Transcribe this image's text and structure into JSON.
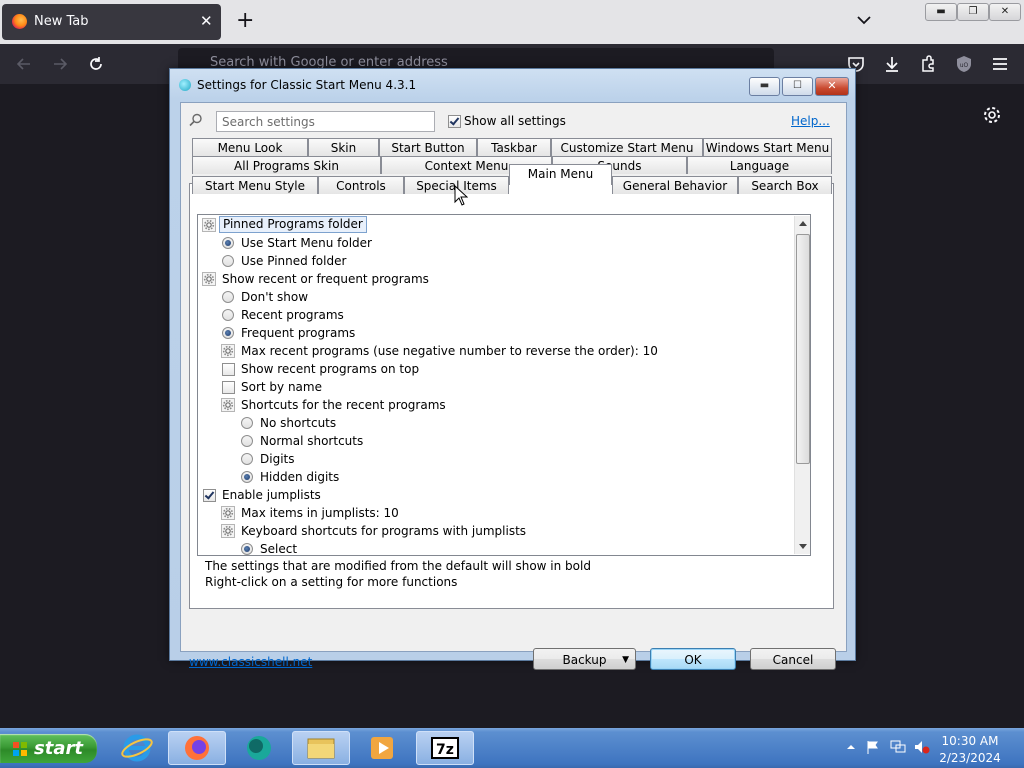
{
  "browser": {
    "tab_title": "New Tab",
    "url_placeholder": "Search with Google or enter address"
  },
  "dialog": {
    "title": "Settings for Classic Start Menu 4.3.1",
    "search_placeholder": "Search settings",
    "show_all_label": "Show all settings",
    "show_all_checked": true,
    "help_link": "Help...",
    "tabs_row1": [
      "Menu Look",
      "Skin",
      "Start Button",
      "Taskbar",
      "Customize Start Menu",
      "Windows Start Menu"
    ],
    "tabs_row2": [
      "All Programs Skin",
      "Context Menu",
      "Sounds",
      "Language"
    ],
    "tabs_row3": [
      "Start Menu Style",
      "Controls",
      "Special Items",
      "Main Menu",
      "General Behavior",
      "Search Box"
    ],
    "active_tab": "Main Menu",
    "settings": [
      {
        "label": "Pinned Programs folder",
        "kind": "group",
        "level": 0
      },
      {
        "label": "Use Start Menu folder",
        "kind": "radio",
        "checked": true,
        "level": 1
      },
      {
        "label": "Use Pinned folder",
        "kind": "radio",
        "checked": false,
        "level": 1
      },
      {
        "label": "Show recent or frequent programs",
        "kind": "group",
        "level": 0
      },
      {
        "label": "Don't show",
        "kind": "radio",
        "checked": false,
        "level": 1
      },
      {
        "label": "Recent programs",
        "kind": "radio",
        "checked": false,
        "level": 1
      },
      {
        "label": "Frequent programs",
        "kind": "radio",
        "checked": true,
        "level": 1
      },
      {
        "label": "Max recent programs (use negative number to reverse the order): 10",
        "kind": "group",
        "level": 1
      },
      {
        "label": "Show recent programs on top",
        "kind": "check",
        "checked": false,
        "level": 1
      },
      {
        "label": "Sort by name",
        "kind": "check",
        "checked": false,
        "level": 1
      },
      {
        "label": "Shortcuts for the recent programs",
        "kind": "group",
        "level": 1
      },
      {
        "label": "No shortcuts",
        "kind": "radio",
        "checked": false,
        "level": 2
      },
      {
        "label": "Normal shortcuts",
        "kind": "radio",
        "checked": false,
        "level": 2
      },
      {
        "label": "Digits",
        "kind": "radio",
        "checked": false,
        "level": 2
      },
      {
        "label": "Hidden digits",
        "kind": "radio",
        "checked": true,
        "level": 2
      },
      {
        "label": "Enable jumplists",
        "kind": "check",
        "checked": true,
        "level": 0
      },
      {
        "label": "Max items in jumplists: 10",
        "kind": "group",
        "level": 1
      },
      {
        "label": "Keyboard shortcuts for programs with jumplists",
        "kind": "group",
        "level": 1
      },
      {
        "label": "Select",
        "kind": "radio",
        "checked": true,
        "level": 2
      }
    ],
    "note_line1": "The settings that are modified from the default will show in bold",
    "note_line2": "Right-click on a setting for more functions",
    "site_link": "www.classicshell.net",
    "backup_label": "Backup",
    "ok_label": "OK",
    "cancel_label": "Cancel"
  },
  "taskbar": {
    "start_label": "start",
    "time": "10:30 AM",
    "date": "2/23/2024"
  },
  "colors": {
    "link": "#0066cc",
    "firefox_dark": "#2b2a33",
    "taskbar_blue": "#3e74c0",
    "start_green": "#3a9a35"
  }
}
